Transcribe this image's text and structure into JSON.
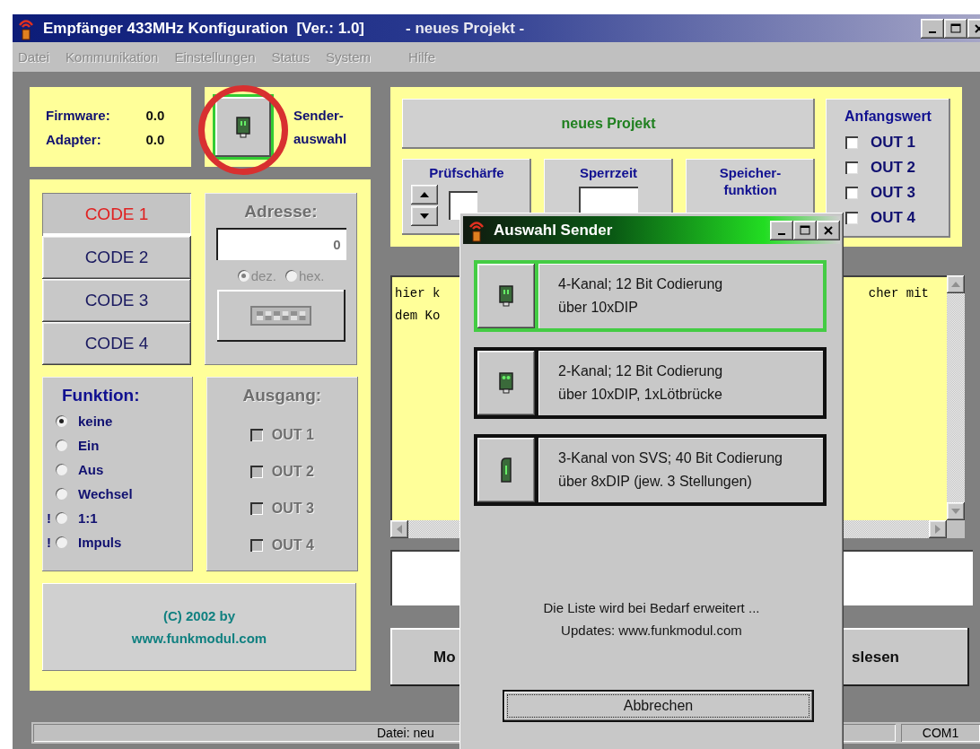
{
  "window": {
    "title": "Empfänger 433MHz Konfiguration  [Ver.: 1.0]",
    "project": "- neues Projekt -"
  },
  "menu": [
    {
      "label": "Datei",
      "disabled": true
    },
    {
      "label": "Kommunikation",
      "disabled": true
    },
    {
      "label": "Einstellungen",
      "disabled": true
    },
    {
      "label": "Status",
      "disabled": true
    },
    {
      "label": "System",
      "disabled": true
    },
    {
      "label": "Hilfe",
      "disabled": true
    }
  ],
  "info": {
    "firmware_label": "Firmware:",
    "firmware": "0.0",
    "adapter_label": "Adapter:",
    "adapter": "0.0"
  },
  "sender_button": {
    "label": [
      "Sender-",
      "auswahl"
    ],
    "highlighted": true
  },
  "codes": [
    {
      "label": "CODE 1",
      "selected": true
    },
    {
      "label": "CODE 2",
      "selected": false
    },
    {
      "label": "CODE 3",
      "selected": false
    },
    {
      "label": "CODE 4",
      "selected": false
    }
  ],
  "address": {
    "label": "Adresse:",
    "value": "0",
    "disabled": true,
    "formats": [
      {
        "label": "dez.",
        "selected": true
      },
      {
        "label": "hex.",
        "selected": false
      }
    ]
  },
  "function": {
    "label": "Funktion:",
    "options": [
      {
        "label": "keine",
        "selected": true
      },
      {
        "label": "Ein",
        "selected": false
      },
      {
        "label": "Aus",
        "selected": false
      },
      {
        "label": "Wechsel",
        "selected": false
      },
      {
        "label": "1:1",
        "selected": false,
        "prefix": "!"
      },
      {
        "label": "Impuls",
        "selected": false,
        "prefix": "!"
      }
    ]
  },
  "output": {
    "label": "Ausgang:",
    "disabled": true,
    "items": [
      {
        "label": "OUT 1",
        "checked": false
      },
      {
        "label": "OUT 2",
        "checked": false
      },
      {
        "label": "OUT 3",
        "checked": false
      },
      {
        "label": "OUT 4",
        "checked": false
      }
    ]
  },
  "copyright": [
    "(C)  2002 by",
    "www.funkmodul.com"
  ],
  "project_name": "neues Projekt",
  "settings": [
    {
      "label": [
        "Prüfschärfe"
      ],
      "kind": "spin"
    },
    {
      "label": [
        "Sperrzeit"
      ],
      "kind": "field"
    },
    {
      "label": [
        "Speicher-",
        "funktion"
      ],
      "kind": "plain"
    }
  ],
  "initial": {
    "label": "Anfangswert",
    "items": [
      {
        "label": "OUT 1",
        "checked": false
      },
      {
        "label": "OUT 2",
        "checked": false
      },
      {
        "label": "OUT 3",
        "checked": false
      },
      {
        "label": "OUT 4",
        "checked": false
      }
    ]
  },
  "memo": {
    "left": [
      "hier k",
      "dem Ko"
    ],
    "right": [
      "cher mit"
    ]
  },
  "buttons": [
    "Mo",
    "slesen"
  ],
  "status_bar": {
    "file": "Datei:  neu",
    "port": "COM1"
  },
  "dialog": {
    "title": "Auswahl Sender",
    "options": [
      {
        "lines": [
          "4-Kanal; 12 Bit Codierung",
          "über 10xDIP"
        ],
        "kind": "slim",
        "selected": true
      },
      {
        "lines": [
          "2-Kanal; 12 Bit Codierung",
          "über 10xDIP, 1xLötbrücke"
        ],
        "kind": "wide",
        "selected": false
      },
      {
        "lines": [
          "3-Kanal von SVS; 40 Bit Codierung",
          "über 8xDIP (jew. 3 Stellungen)"
        ],
        "kind": "round",
        "selected": false
      }
    ],
    "note": [
      "Die Liste wird bei Bedarf erweitert ...",
      "Updates: www.funkmodul.com"
    ],
    "cancel": "Abbrechen"
  }
}
